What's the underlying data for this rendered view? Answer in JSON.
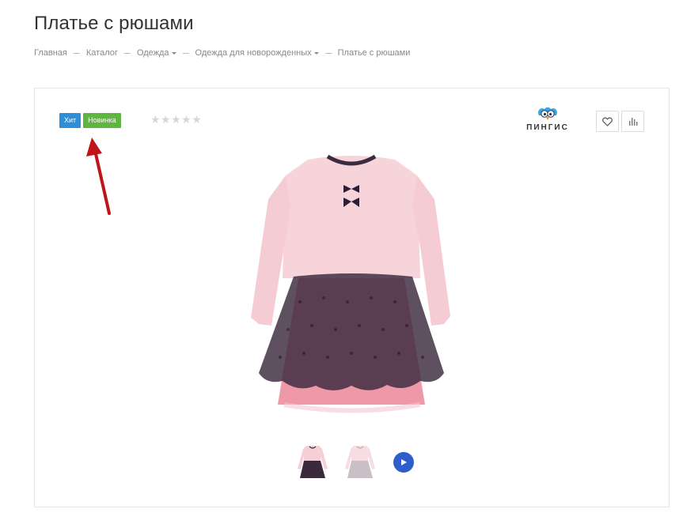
{
  "title": "Платье с рюшами",
  "breadcrumb": {
    "items": [
      {
        "label": "Главная",
        "dropdown": false
      },
      {
        "label": "Каталог",
        "dropdown": false
      },
      {
        "label": "Одежда",
        "dropdown": true
      },
      {
        "label": "Одежда для новорожденных",
        "dropdown": true
      },
      {
        "label": "Платье с рюшами",
        "dropdown": false
      }
    ]
  },
  "badges": {
    "hit": "Хит",
    "new": "Новинка",
    "hit_color": "#2e8fd8",
    "new_color": "#5db63d"
  },
  "rating": {
    "stars_text": "★★★★★",
    "value": 0,
    "max": 5
  },
  "brand": {
    "name": "ПИНГИС",
    "logo_icon": "penguin-logo-icon"
  },
  "actions": {
    "wishlist_icon": "heart-icon",
    "compare_icon": "bar-chart-icon"
  },
  "product_image": {
    "subject": "pink-dress-with-tulle-skirt",
    "colors": {
      "bodice": "#f6cfd6",
      "tulle": "#3a2a3c",
      "underskirt": "#ef8fa0"
    }
  },
  "gallery": {
    "thumbnails": [
      "thumb-dress-dark",
      "thumb-dress-light"
    ],
    "video_icon": "play-icon",
    "video_color": "#2e5ec9"
  },
  "annotation": {
    "arrow_color": "#c0141b"
  }
}
